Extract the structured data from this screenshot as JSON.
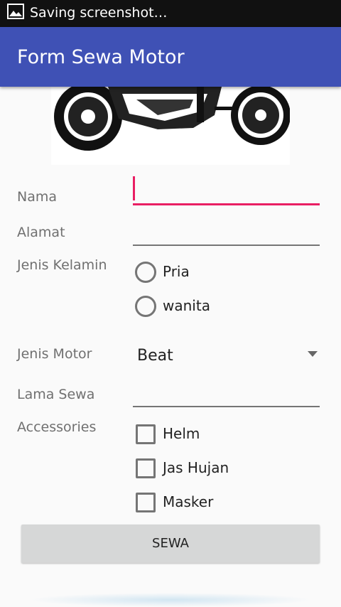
{
  "status_bar": {
    "text": "Saving screenshot…",
    "icon": "image-icon"
  },
  "app_bar": {
    "title": "Form Sewa Motor",
    "color": "#3f51b5"
  },
  "form": {
    "nama": {
      "label": "Nama",
      "value": ""
    },
    "alamat": {
      "label": "Alamat",
      "value": ""
    },
    "jenis_kelamin": {
      "label": "Jenis Kelamin",
      "options": [
        "Pria",
        "wanita"
      ]
    },
    "jenis_motor": {
      "label": "Jenis Motor",
      "selected": "Beat"
    },
    "lama_sewa": {
      "label": "Lama Sewa",
      "value": ""
    },
    "accessories": {
      "label": "Accessories",
      "options": [
        "Helm",
        "Jas Hujan",
        "Masker"
      ]
    },
    "submit_label": "SEWA"
  },
  "colors": {
    "accent": "#e91e63",
    "primary": "#3f51b5"
  }
}
